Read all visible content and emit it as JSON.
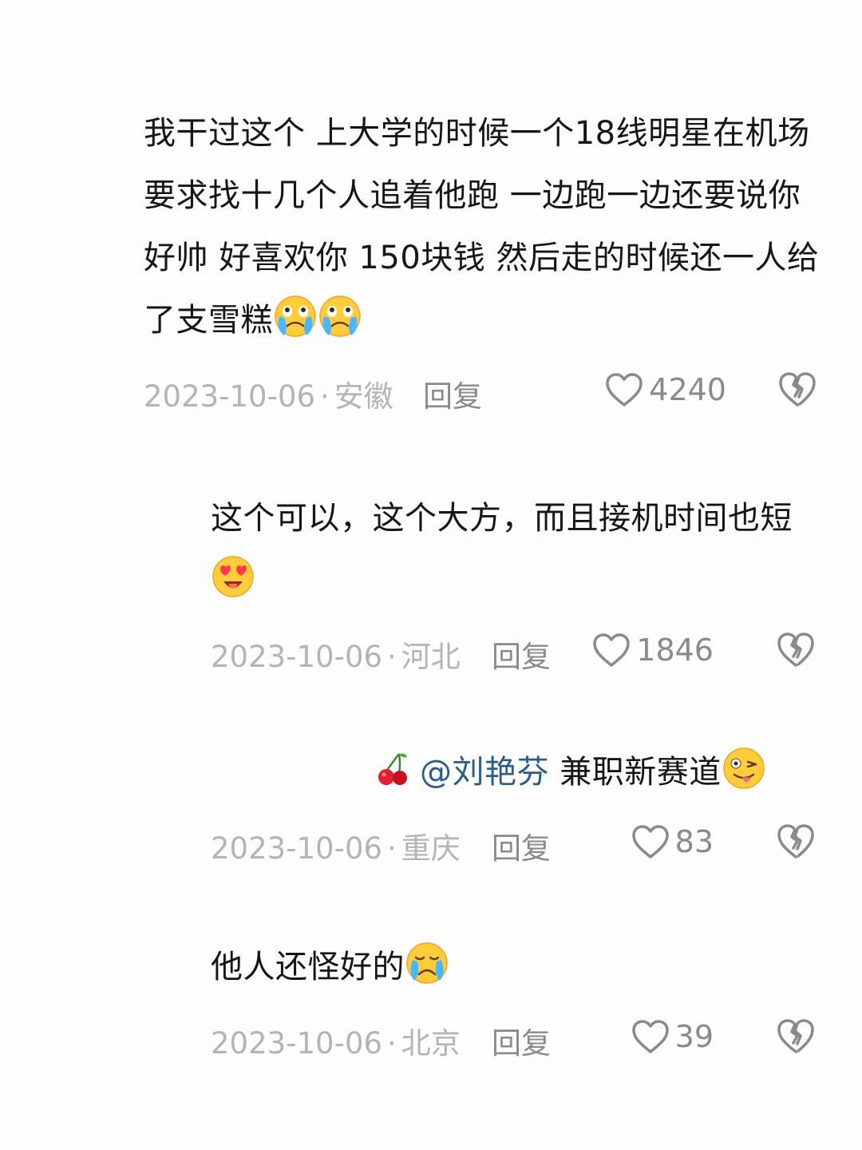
{
  "comments": [
    {
      "text": "我干过这个 上大学的时候一个18线明星在机场要求找十几个人追着他跑 一边跑一边还要说你好帅 好喜欢你  150块钱 然后走的时候还一人给了支雪糕",
      "emojis": [
        "crying-emoji",
        "crying-emoji"
      ],
      "date": "2023-10-06",
      "location": "安徽",
      "reply_label": "回复",
      "likes": "4240"
    },
    {
      "text": "这个可以，这个大方，而且接机时间也短",
      "emojis": [
        "heart-eyes-emoji"
      ],
      "date": "2023-10-06",
      "location": "河北",
      "reply_label": "回复",
      "likes": "1846"
    },
    {
      "mention": "@刘艳芬",
      "text": " 兼职新赛道",
      "emojis": [
        "wink-tongue-emoji"
      ],
      "date": "2023-10-06",
      "location": "重庆",
      "reply_label": "回复",
      "likes": "83"
    },
    {
      "text": "他人还怪好的",
      "emojis": [
        "crying-emoji"
      ],
      "date": "2023-10-06",
      "location": "北京",
      "reply_label": "回复",
      "likes": "39"
    }
  ],
  "separator": "·"
}
